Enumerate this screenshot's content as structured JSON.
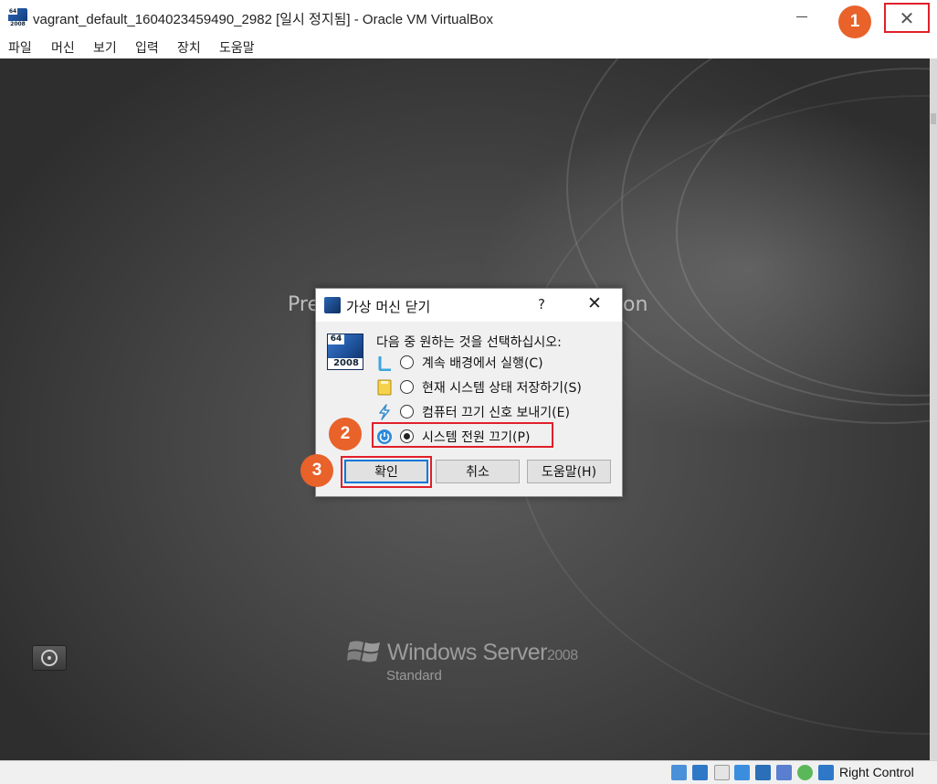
{
  "window": {
    "title": "vagrant_default_1604023459490_2982 [일시 정지됨] - Oracle VM VirtualBox",
    "app_icon_badge": "64",
    "app_icon_year": "2008",
    "close_glyph": "✕"
  },
  "menu": {
    "items": [
      {
        "label": "파일"
      },
      {
        "label": "머신"
      },
      {
        "label": "보기"
      },
      {
        "label": "입력"
      },
      {
        "label": "장치"
      },
      {
        "label": "도움말"
      }
    ]
  },
  "vm_screen": {
    "press_text_left": "Pre",
    "press_text_right": "on",
    "brand": "Windows Server",
    "brand_version": "2008",
    "edition": "Standard"
  },
  "dialog": {
    "title": "가상 머신 닫기",
    "help_glyph": "?",
    "close_glyph": "✕",
    "logo_badge": "64",
    "logo_year": "2008",
    "prompt": "다음 중 원하는 것을 선택하십시오:",
    "options": [
      {
        "label": "계속 배경에서 실행(C)",
        "icon": "background-run-icon",
        "selected": false
      },
      {
        "label": "현재 시스템 상태 저장하기(S)",
        "icon": "save-state-icon",
        "selected": false
      },
      {
        "label": "컴퓨터 끄기 신호 보내기(E)",
        "icon": "acpi-shutdown-icon",
        "selected": false
      },
      {
        "label": "시스템 전원 끄기(P)",
        "icon": "power-off-icon",
        "selected": true
      }
    ],
    "buttons": {
      "ok": "확인",
      "cancel": "취소",
      "help": "도움말(H)"
    }
  },
  "steps": {
    "one": "1",
    "two": "2",
    "three": "3"
  },
  "statusbar": {
    "host_key": "Right Control"
  },
  "colors": {
    "highlight": "#e0202a",
    "step_badge": "#e8622a",
    "primary_button_border": "#0078d7"
  }
}
